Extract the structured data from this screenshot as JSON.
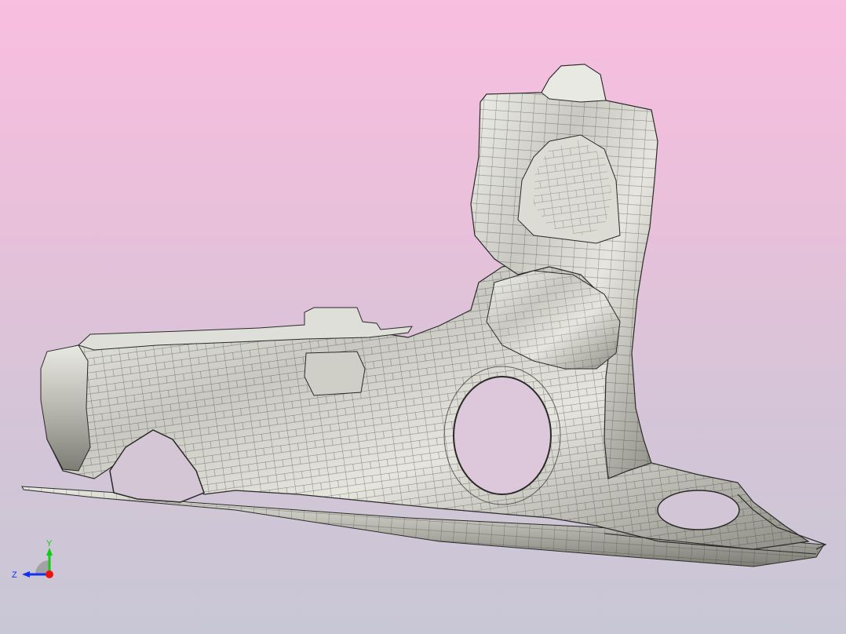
{
  "viewport": {
    "background_top": "#f9bee0",
    "background_bottom": "#c8c7d5",
    "model_fill": "#c9c9c2",
    "model_edge": "#2a2a28",
    "model_highlight": "#f4f4ee"
  },
  "triad": {
    "x_color": "#ee1111",
    "y_color": "#11cc11",
    "z_color": "#1133ee",
    "y_label": "Y",
    "z_label": "Z"
  }
}
